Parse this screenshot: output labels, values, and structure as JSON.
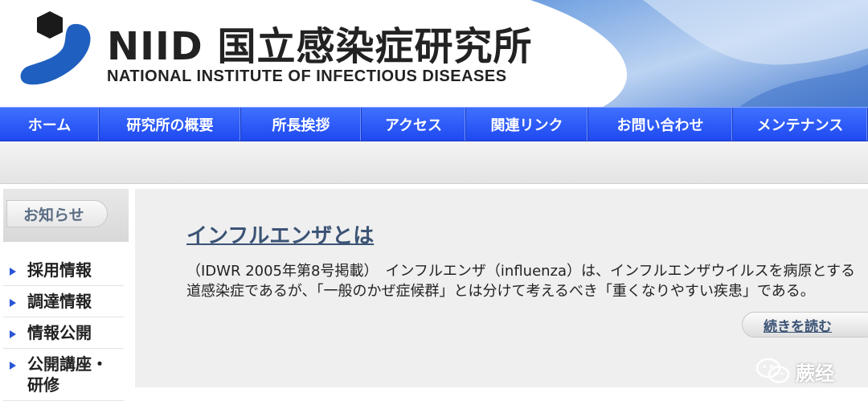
{
  "header": {
    "title_jp": "NIID 国立感染症研究所",
    "title_en": "NATIONAL INSTITUTE OF INFECTIOUS DISEASES",
    "brand_color": "#1f5fbf"
  },
  "nav": {
    "items": [
      {
        "label": "ホーム"
      },
      {
        "label": "研究所の概要"
      },
      {
        "label": "所長挨拶"
      },
      {
        "label": "アクセス"
      },
      {
        "label": "関連リンク"
      },
      {
        "label": "お問い合わせ"
      },
      {
        "label": "メンテナンス"
      }
    ],
    "color": "#2b55f5"
  },
  "sidebar": {
    "header": "お知らせ",
    "items": [
      {
        "label": "採用情報"
      },
      {
        "label": "調達情報"
      },
      {
        "label": "情報公開"
      },
      {
        "label": "公開講座・研修"
      }
    ]
  },
  "article": {
    "title": "インフルエンザとは",
    "line1": "（IDWR 2005年第8号掲載）　インフルエンザ（influenza）は、インフルエンザウイルスを病原とする",
    "line2": "道感染症であるが、「一般のかぜ症候群」とは分けて考えるべき「重くなりやすい疾患」である。",
    "readmore": "続きを読む"
  },
  "watermark": {
    "text": "蕨经",
    "icon": "wechat-icon"
  }
}
